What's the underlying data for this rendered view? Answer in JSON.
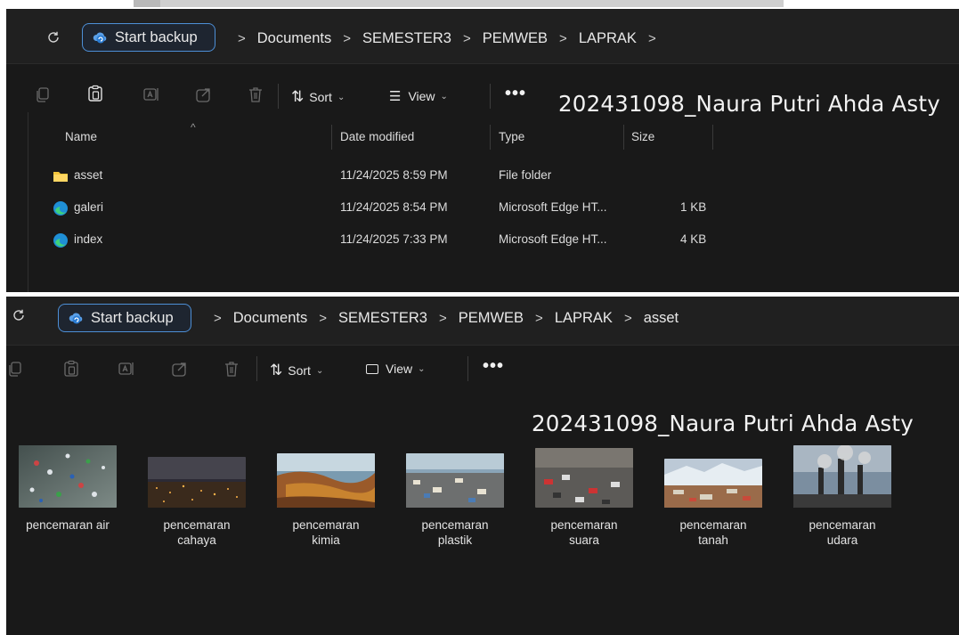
{
  "window_top": {
    "breadcrumbs": [
      "Documents",
      "SEMESTER3",
      "PEMWEB",
      "LAPRAK"
    ],
    "backup_label": "Start backup",
    "toolbar": {
      "sort_label": "Sort",
      "view_label": "View",
      "more_label": "•••"
    },
    "author_text": "202431098_Naura Putri Ahda Asty",
    "columns": {
      "name": "Name",
      "date": "Date modified",
      "type": "Type",
      "size": "Size"
    },
    "files": [
      {
        "name": "asset",
        "icon": "folder-icon",
        "date": "11/24/2025 8:59 PM",
        "type": "File folder",
        "size": ""
      },
      {
        "name": "galeri",
        "icon": "edge-icon",
        "date": "11/24/2025 8:54 PM",
        "type": "Microsoft Edge HT...",
        "size": "1 KB"
      },
      {
        "name": "index",
        "icon": "edge-icon",
        "date": "11/24/2025 7:33 PM",
        "type": "Microsoft Edge HT...",
        "size": "4 KB"
      }
    ]
  },
  "window_bottom": {
    "breadcrumbs": [
      "Documents",
      "SEMESTER3",
      "PEMWEB",
      "LAPRAK",
      "asset"
    ],
    "backup_label": "Start backup",
    "toolbar": {
      "sort_label": "Sort",
      "view_label": "View",
      "more_label": "•••"
    },
    "author_text": "202431098_Naura Putri Ahda Asty",
    "images": [
      {
        "line1": "pencemaran air",
        "line2": "",
        "theme": "water"
      },
      {
        "line1": "pencemaran",
        "line2": "cahaya",
        "theme": "light"
      },
      {
        "line1": "pencemaran",
        "line2": "kimia",
        "theme": "chemical"
      },
      {
        "line1": "pencemaran",
        "line2": "plastik",
        "theme": "plastic"
      },
      {
        "line1": "pencemaran",
        "line2": "suara",
        "theme": "noise"
      },
      {
        "line1": "pencemaran",
        "line2": "tanah",
        "theme": "soil"
      },
      {
        "line1": "pencemaran",
        "line2": "udara",
        "theme": "air"
      }
    ]
  },
  "colors": {
    "background": "#191919",
    "accent": "#4d8fd6",
    "folder": "#f4c53b",
    "text": "#e8e8e8"
  }
}
